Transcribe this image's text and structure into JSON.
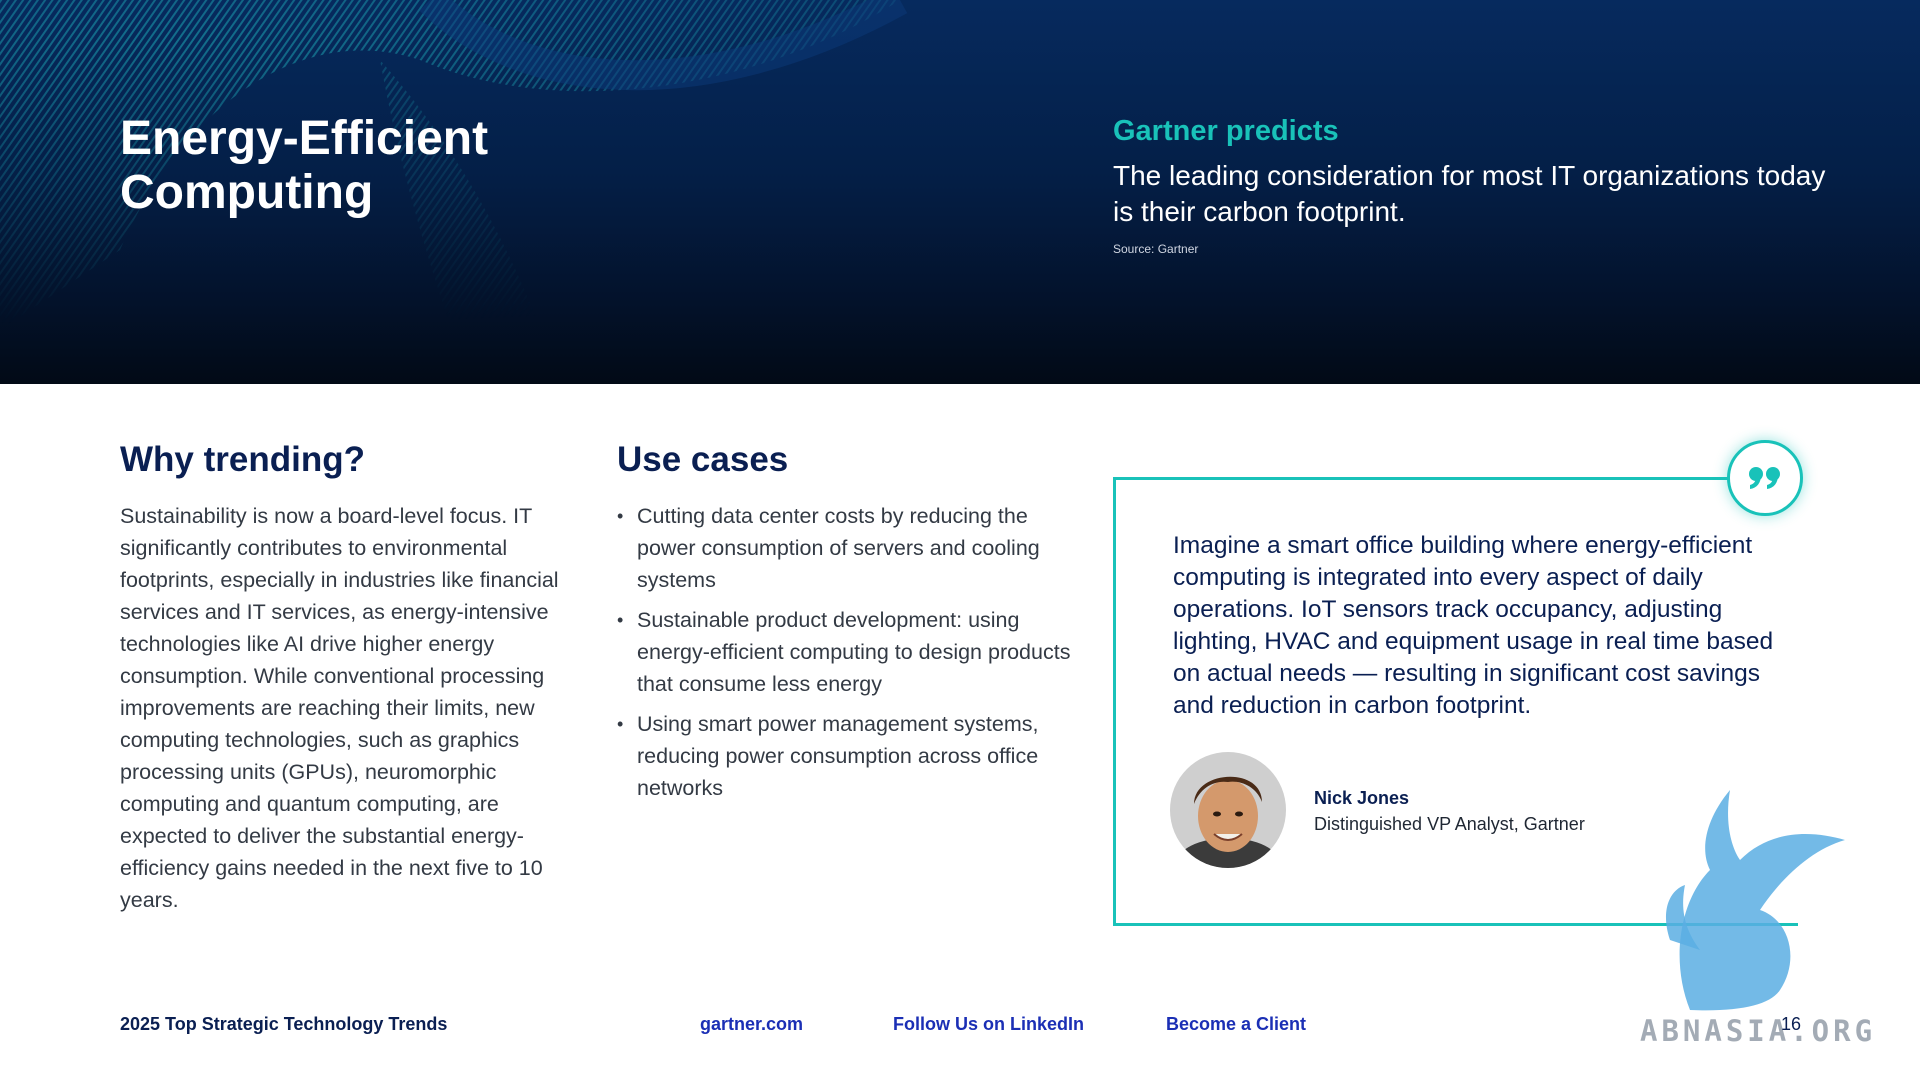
{
  "hero": {
    "title": "Energy-Efficient\nComputing",
    "predict_heading": "Gartner predicts",
    "predict_text": "The leading consideration for most IT organizations today is their carbon footprint.",
    "source": "Source: Gartner"
  },
  "why": {
    "heading": "Why trending?",
    "text": "Sustainability is now a board-level focus. IT significantly contributes to environmental footprints, especially in industries like financial services and IT services, as energy-intensive technologies like AI drive higher energy consumption. While conventional processing improvements are reaching their limits, new computing technologies, such as graphics processing units (GPUs), neuromorphic computing and quantum computing, are expected to deliver the substantial energy-efficiency gains needed in the next five to 10 years."
  },
  "use_cases": {
    "heading": "Use cases",
    "items": [
      "Cutting data center costs by reducing the power consumption of servers and cooling systems",
      "Sustainable product development: using energy-efficient computing to design products that consume less energy",
      "Using smart power management systems, reducing power consumption across office networks"
    ]
  },
  "quote": {
    "text": "Imagine a smart office building where energy-efficient computing is integrated into every aspect of daily operations. IoT sensors track occupancy, adjusting lighting, HVAC and equipment usage in real time based on actual needs — resulting in significant cost savings and reduction in carbon footprint.",
    "name": "Nick Jones",
    "role": "Distinguished VP Analyst, Gartner"
  },
  "footer": {
    "title": "2025 Top Strategic Technology Trends",
    "link1": "gartner.com",
    "link2": "Follow Us on LinkedIn",
    "link3": "Become a Client",
    "page": "16"
  },
  "watermark": {
    "text": "ABNASIA.ORG"
  },
  "colors": {
    "accent": "#19c2b9",
    "navy": "#0a1f52",
    "link": "#1b2fb5"
  },
  "icons": [
    "quote-icon",
    "avatar-photo",
    "griffin-watermark"
  ]
}
